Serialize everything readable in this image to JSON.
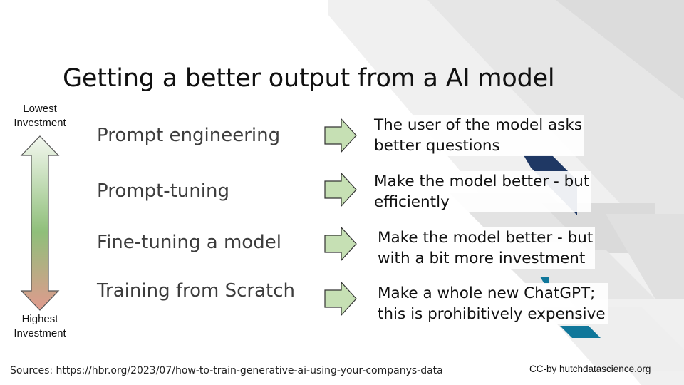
{
  "slide": {
    "title": "Getting a better output from a AI model",
    "scale": {
      "top_label": "Lowest\nInvestment",
      "bottom_label": "Highest\nInvestment",
      "gradient_top": "#f4f8f0",
      "gradient_middle": "#8fbf7a",
      "gradient_bottom": "#e09a8e"
    },
    "rows": [
      {
        "method": "Prompt engineering",
        "description": "The user of the model asks\nbetter questions"
      },
      {
        "method": "Prompt-tuning",
        "description": "Make the model better - but\nefficiently"
      },
      {
        "method": "Fine-tuning a model",
        "description": "Make the model better - but\nwith a bit more investment"
      },
      {
        "method": "Training from Scratch",
        "description": "Make a whole new ChatGPT;\nthis is prohibitively expensive"
      }
    ],
    "arrow_fill": "#c6e0b4",
    "sources": "Sources: https://hbr.org/2023/07/how-to-train-generative-ai-using-your-companys-data",
    "license": "CC-by hutchdatascience.org",
    "decor_colors": {
      "light_gray": "#eeeeee",
      "mid_gray": "#e0e0e0",
      "navy": "#1f3864",
      "teal": "#10779a"
    }
  }
}
